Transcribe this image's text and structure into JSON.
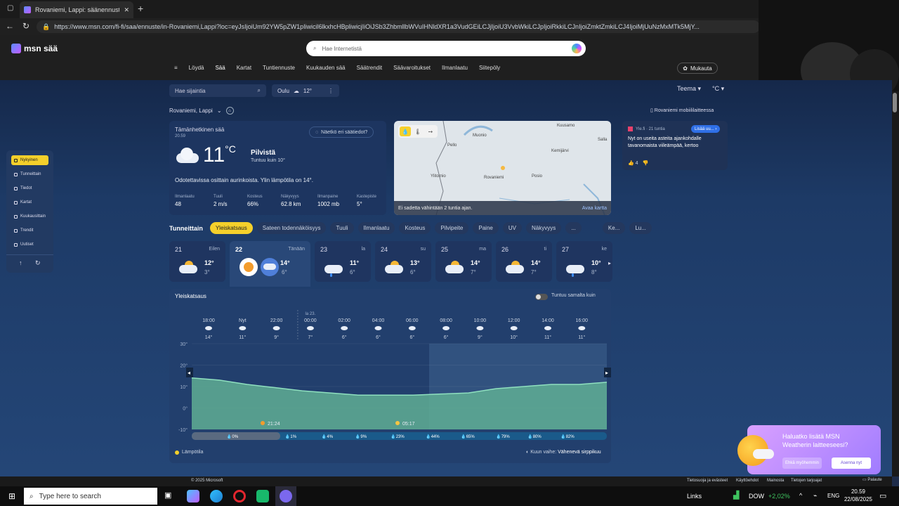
{
  "browser": {
    "tab_title": "Rovaniemi, Lappi: säänennuste | M",
    "url": "https://www.msn.com/fi-fi/saa/ennuste/in-Rovaniemi,Lappi?loc=eyJsIjoiUm92YW5pZW1pIiwicil6lkxhcHBpliwicjIiOiJSb3ZhbmllbWVuIHNldXR1a3VudGEiLCJjIjoiU3VvbWkiLCJpIjoiRkkiLCJnIjoiZmktZmkiLCJ4IjoiMjUuNzMxMTk5MjY..."
  },
  "header": {
    "logo_text": "msn sää",
    "search_placeholder": "Hae Internetistä",
    "customize_label": "Mukauta",
    "nav": [
      "Löydä",
      "Sää",
      "Kartat",
      "Tuntiennuste",
      "Kuukauden sää",
      "Säätrendit",
      "Säävaroitukset",
      "Ilmanlaatu",
      "Siitepöly"
    ]
  },
  "toolbar": {
    "location_search_placeholder": "Hae sijaintia",
    "saved_location": "Oulu",
    "saved_temp": "12°",
    "theme_label": "Teema",
    "unit_label": "°C"
  },
  "location": {
    "name": "Rovaniemi, Lappi",
    "mobile_link": "Rovaniemi mobiililaitteessa"
  },
  "sidebar": {
    "items": [
      "Nykyinen",
      "Tunneittain",
      "Tiedot",
      "Kartat",
      "Kuukausittain",
      "Trendit",
      "Uutiset"
    ]
  },
  "current": {
    "title": "Tämänhetkinen sää",
    "time": "20.59",
    "feedback": "Näetkö eri säätiedot?",
    "temp": "11",
    "unit": "°C",
    "condition": "Pilvistä",
    "feels_like_label": "Tuntuu kuin",
    "feels_like": "10°",
    "description": "Odotettavissa osittain aurinkoista. Ylin lämpötila on 14°.",
    "stats": [
      {
        "label": "Ilmanlaatu",
        "value": "48"
      },
      {
        "label": "Tuuli",
        "value": "2 m/s"
      },
      {
        "label": "Kosteus",
        "value": "66%"
      },
      {
        "label": "Näkyvyys",
        "value": "62.8 km"
      },
      {
        "label": "Ilmanpaine",
        "value": "1002 mb"
      },
      {
        "label": "Kastepiste",
        "value": "5°"
      }
    ]
  },
  "map": {
    "towns": [
      "Pello",
      "Muonio",
      "Kemijärvi",
      "Salla",
      "Ylitornio",
      "Rovaniemi",
      "Posio",
      "Kuusamo"
    ],
    "footer_text": "Ei sadetta vähintään 2 tuntia ajan.",
    "open_label": "Avaa kartta"
  },
  "news": {
    "source": "Yle.fi · 21 tuntia",
    "more_label": "Lisää uu...",
    "headline": "Nyt on useita asteita ajankohdalle tavanomaista viileämpää, kertoo",
    "likes": "4"
  },
  "tabs": [
    "Tunneittain",
    "Yleiskatsaus",
    "Sateen todennäköisyys",
    "Tuuli",
    "Ilmanlaatu",
    "Kosteus",
    "Pilvipeite",
    "Paine",
    "UV",
    "Näkyvyys",
    "...",
    "Ke...",
    "Lu..."
  ],
  "days": [
    {
      "num": "21",
      "name": "Eilen",
      "hi": "12°",
      "lo": "3°"
    },
    {
      "num": "22",
      "name": "Tänään",
      "hi": "14°",
      "lo": "6°"
    },
    {
      "num": "23",
      "name": "la",
      "hi": "11°",
      "lo": "6°"
    },
    {
      "num": "24",
      "name": "su",
      "hi": "13°",
      "lo": "6°"
    },
    {
      "num": "25",
      "name": "ma",
      "hi": "14°",
      "lo": "7°"
    },
    {
      "num": "26",
      "name": "ti",
      "hi": "14°",
      "lo": "7°"
    },
    {
      "num": "27",
      "name": "ke",
      "hi": "10°",
      "lo": "8°"
    }
  ],
  "overview": {
    "title": "Yleiskatsaus",
    "toggle_label": "Tuntuu samalta kuin",
    "date_marker": "la 23.",
    "hours": [
      "18:00",
      "Nyt",
      "22:00",
      "00:00",
      "02:00",
      "04:00",
      "06:00",
      "08:00",
      "10:00",
      "12:00",
      "14:00",
      "16:00"
    ],
    "hour_temps": [
      "14°",
      "11°",
      "9°",
      "7°",
      "6°",
      "6°",
      "6°",
      "6°",
      "9°",
      "10°",
      "11°",
      "11°"
    ],
    "y_ticks": [
      "30°",
      "20°",
      "10°",
      "0°",
      "-10°"
    ],
    "sunset": "21:24",
    "sunrise": "05:17",
    "precip": [
      "0%",
      "1%",
      "4%",
      "9%",
      "23%",
      "44%",
      "65%",
      "79%",
      "80%",
      "82%"
    ],
    "legend": "Lämpötila",
    "moon_label": "Kuun vaihe:",
    "moon_phase": "Vähenevä sirppikuu"
  },
  "promo": {
    "text": "Haluatko lisätä MSN Weatherin laitteeseesi?",
    "later": "Ehkä myöhemmin",
    "add": "Asenna nyt"
  },
  "footer": {
    "copyright": "© 2025 Microsoft",
    "links": [
      "Tietosuoja ja evästeet",
      "Käyttöehdot",
      "Mainosta",
      "Tietojen tarjoajat"
    ],
    "feedback": "Palaute"
  },
  "taskbar": {
    "search_placeholder": "Type here to search",
    "links": "Links",
    "ticker": "DOW",
    "ticker_change": "+2,02%",
    "lang": "ENG",
    "time": "20.59",
    "date": "22/08/2025"
  }
}
